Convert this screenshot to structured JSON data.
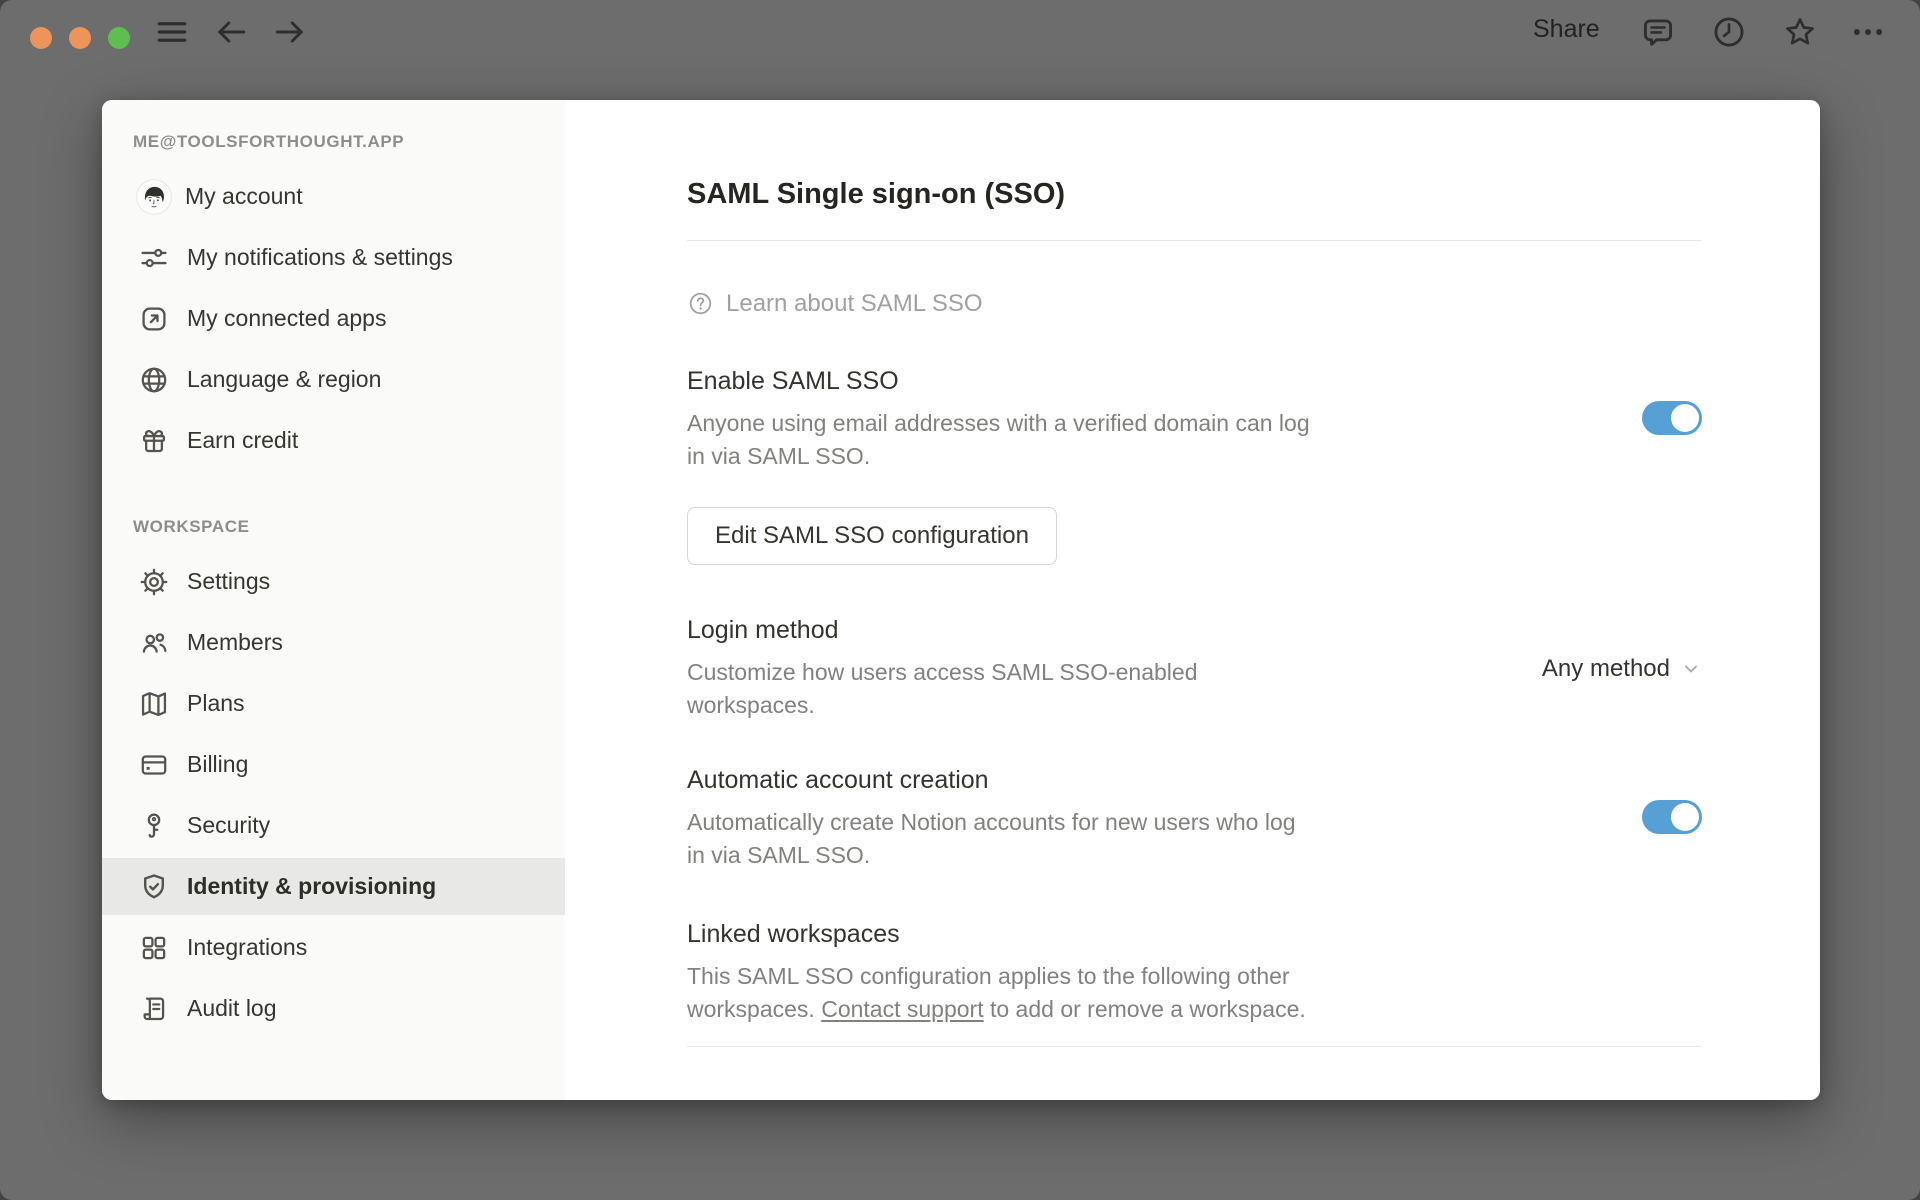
{
  "chrome": {
    "share_label": "Share",
    "icons": [
      "menu-icon",
      "back-icon",
      "forward-icon",
      "comments-icon",
      "history-icon",
      "star-icon",
      "more-icon"
    ],
    "traffic_lights": [
      "close",
      "minimize",
      "zoom"
    ]
  },
  "sidebar": {
    "account_header": "ME@TOOLSFORTHOUGHT.APP",
    "workspace_header": "WORKSPACE",
    "account_items": [
      {
        "label": "My account",
        "icon": "avatar"
      },
      {
        "label": "My notifications & settings",
        "icon": "sliders-icon"
      },
      {
        "label": "My connected apps",
        "icon": "external-link-icon"
      },
      {
        "label": "Language & region",
        "icon": "globe-icon"
      },
      {
        "label": "Earn credit",
        "icon": "gift-icon"
      }
    ],
    "workspace_items": [
      {
        "label": "Settings",
        "icon": "gear-icon",
        "selected": false
      },
      {
        "label": "Members",
        "icon": "members-icon",
        "selected": false
      },
      {
        "label": "Plans",
        "icon": "map-icon",
        "selected": false
      },
      {
        "label": "Billing",
        "icon": "credit-card-icon",
        "selected": false
      },
      {
        "label": "Security",
        "icon": "key-icon",
        "selected": false
      },
      {
        "label": "Identity & provisioning",
        "icon": "shield-check-icon",
        "selected": true
      },
      {
        "label": "Integrations",
        "icon": "grid-icon",
        "selected": false
      },
      {
        "label": "Audit log",
        "icon": "audit-log-icon",
        "selected": false
      }
    ]
  },
  "content": {
    "title": "SAML Single sign-on (SSO)",
    "learn_link": "Learn about SAML SSO",
    "sections": {
      "enable": {
        "heading": "Enable SAML SSO",
        "description": "Anyone using email addresses with a verified domain can log in via SAML SSO.",
        "toggle_on": true
      },
      "edit_button_label": "Edit SAML SSO configuration",
      "login": {
        "heading": "Login method",
        "description": "Customize how users access SAML SSO-enabled workspaces.",
        "dropdown_value": "Any method"
      },
      "auto": {
        "heading": "Automatic account creation",
        "description": "Automatically create Notion accounts for new users who log in via SAML SSO.",
        "toggle_on": true
      },
      "linked": {
        "heading": "Linked workspaces",
        "description_before": "This SAML SSO configuration applies to the following other workspaces. ",
        "link_text": "Contact support",
        "description_after": " to add or remove a workspace."
      }
    }
  },
  "colors": {
    "toggle_on": "#57A0D5",
    "chrome_gray": "#6D6D6D",
    "sidebar_bg": "#FAFAF9",
    "selected_item_bg": "#E8E8E6",
    "traffic_close": "#EC9459",
    "traffic_minimize": "#EC9459",
    "traffic_zoom": "#5FBE52",
    "text_dark": "#37352F",
    "text_muted": "#82817D"
  }
}
